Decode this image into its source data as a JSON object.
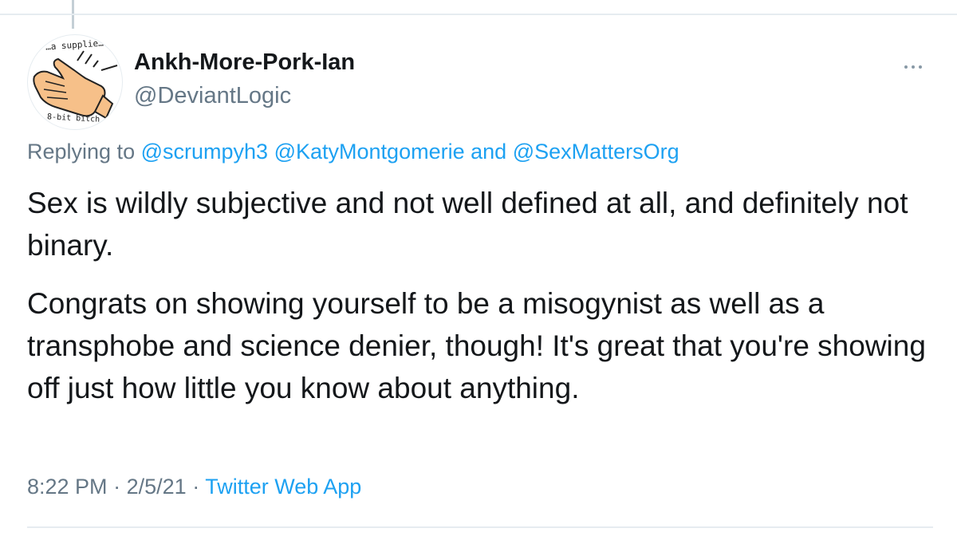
{
  "author": {
    "display_name": "Ankh-More-Pork-Ian",
    "handle": "@DeviantLogic",
    "avatar": {
      "icon": "waving-hand-icon",
      "caption_top": "…a supplie…",
      "caption_bottom": "8-bit bitch"
    }
  },
  "reply": {
    "prefix": "Replying to",
    "mentions": [
      "@scrumpyh3",
      "@KatyMontgomerie",
      "@SexMattersOrg"
    ],
    "separator": " ",
    "conjunction": "and"
  },
  "tweet": {
    "paragraphs": [
      "Sex is wildly subjective and not well defined at all, and definitely not binary.",
      "Congrats on showing yourself to be a misogynist as well as a transphobe and science denier, though! It's great that you're showing off just how little you know about anything."
    ]
  },
  "meta": {
    "time": "8:22 PM",
    "date": "2/5/21",
    "dot": "·",
    "source": "Twitter Web App"
  },
  "icons": {
    "more": "more-options-icon"
  },
  "colors": {
    "link": "#1da1f2",
    "secondary_text": "#657786",
    "primary_text": "#14171a",
    "divider": "#e6ecf0"
  }
}
